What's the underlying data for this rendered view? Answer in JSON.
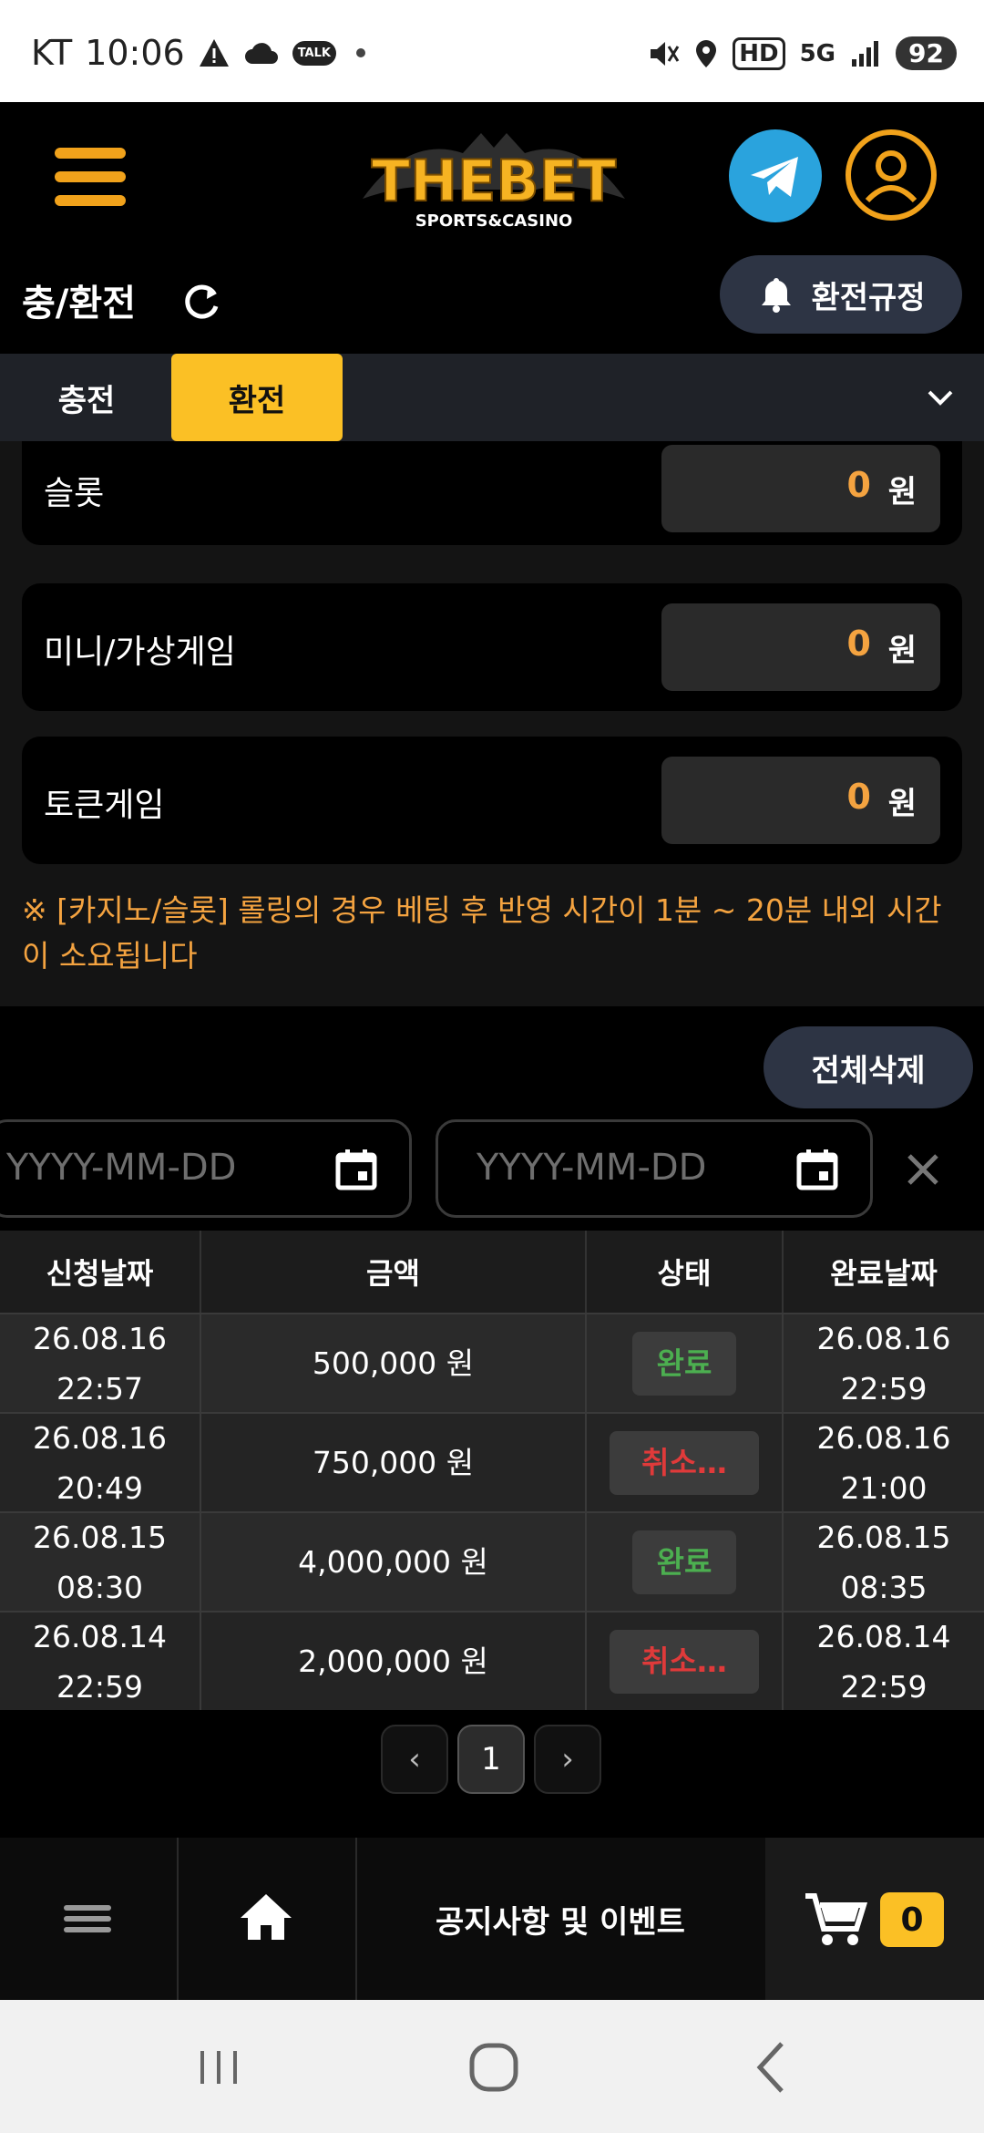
{
  "status_bar": {
    "carrier": "KT",
    "time": "10:06",
    "network": "5G",
    "battery": "92",
    "hd_label": "HD",
    "talk_label": "TALK"
  },
  "header": {
    "logo_main": "THEBET",
    "logo_sub": "SPORTS&CASINO"
  },
  "page": {
    "title": "충/환전",
    "rules_button": "환전규정"
  },
  "tabs": [
    {
      "label": "충전",
      "active": false
    },
    {
      "label": "환전",
      "active": true
    }
  ],
  "balances": [
    {
      "label": "슬롯",
      "value": "0",
      "unit": "원"
    },
    {
      "label": "미니/가상게임",
      "value": "0",
      "unit": "원"
    },
    {
      "label": "토큰게임",
      "value": "0",
      "unit": "원"
    }
  ],
  "notice": "※ [카지노/슬롯] 롤링의 경우 베팅 후 반영 시간이 1분 ~ 20분 내외 시간이 소요됩니다",
  "filters": {
    "delete_all": "전체삭제",
    "start_placeholder": "YYYY-MM-DD",
    "end_placeholder": "YYYY-MM-DD"
  },
  "table": {
    "headers": [
      "신청날짜",
      "금액",
      "상태",
      "완료날짜"
    ],
    "rows": [
      {
        "req_date": "26.08.16",
        "req_time": "22:57",
        "amount": "500,000 원",
        "status": "완료",
        "status_type": "done",
        "done_date": "26.08.16",
        "done_time": "22:59"
      },
      {
        "req_date": "26.08.16",
        "req_time": "20:49",
        "amount": "750,000 원",
        "status": "취소…",
        "status_type": "cancel",
        "done_date": "26.08.16",
        "done_time": "21:00"
      },
      {
        "req_date": "26.08.15",
        "req_time": "08:30",
        "amount": "4,000,000 원",
        "status": "완료",
        "status_type": "done",
        "done_date": "26.08.15",
        "done_time": "08:35"
      },
      {
        "req_date": "26.08.14",
        "req_time": "22:59",
        "amount": "2,000,000 원",
        "status": "취소…",
        "status_type": "cancel",
        "done_date": "26.08.14",
        "done_time": "22:59"
      }
    ]
  },
  "pagination": {
    "prev": "‹",
    "current": "1",
    "next": "›"
  },
  "bottom_nav": {
    "notice_label": "공지사항 및 이벤트",
    "cart_count": "0"
  },
  "colors": {
    "accent": "#fbc025",
    "orange": "#f4a340",
    "done": "#4caf50",
    "cancel": "#e03a3a"
  }
}
